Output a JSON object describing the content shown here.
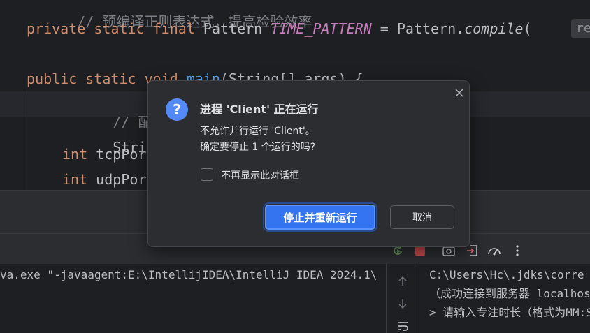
{
  "editor": {
    "line0_comment": "// 预编译正则表达式，提高检验效率",
    "line1": {
      "kw1": "private",
      "kw2": "static",
      "kw3": "final",
      "type": "Pattern",
      "const_name": "TIME_PATTERN",
      "eq": " = ",
      "cls": "Pattern.",
      "method": "compile",
      "paren": "("
    },
    "param_hint": "re",
    "line3": {
      "kw1": "public",
      "kw2": "static",
      "kw3": "void",
      "method": "main",
      "rest": "(String[] args) {"
    },
    "line4_comment": "// 配置服务",
    "line5": "String ser",
    "line6": {
      "kw": "int",
      "rest": " tcpPor"
    },
    "line7": {
      "kw": "int",
      "rest": " udpPor"
    }
  },
  "console": {
    "left_line": "va.exe \"-javaagent:E:\\IntellijIDEA\\IntelliJ IDEA 2024.1\\",
    "right_lines": [
      "C:\\Users\\Hc\\.jdks\\corre",
      "（成功连接到服务器 localhos",
      "> 请输入专注时长（格式为MM:S"
    ]
  },
  "dialog": {
    "title": "进程 'Client' 正在运行",
    "message_line1": "不允许并行运行 'Client'。",
    "message_line2": "确定要停止 1 个运行的吗?",
    "checkbox_label": "不再显示此对话框",
    "primary_button": "停止并重新运行",
    "secondary_button": "取消"
  },
  "icons": {
    "dialog": "question-icon",
    "close": "close-icon",
    "toolbar": [
      "rerun-icon",
      "stop-icon",
      "camera-icon",
      "exit-icon",
      "profiler-icon",
      "more-vertical-icon"
    ],
    "side_strip": [
      "arrow-up-icon",
      "arrow-down-icon",
      "soft-wrap-icon"
    ]
  },
  "colors": {
    "keyword": "#cf8e6d",
    "comment": "#7a7e85",
    "constant": "#c77dbb",
    "function": "#56a8f5",
    "primary_button": "#3574f0",
    "question_icon": "#548af7"
  }
}
